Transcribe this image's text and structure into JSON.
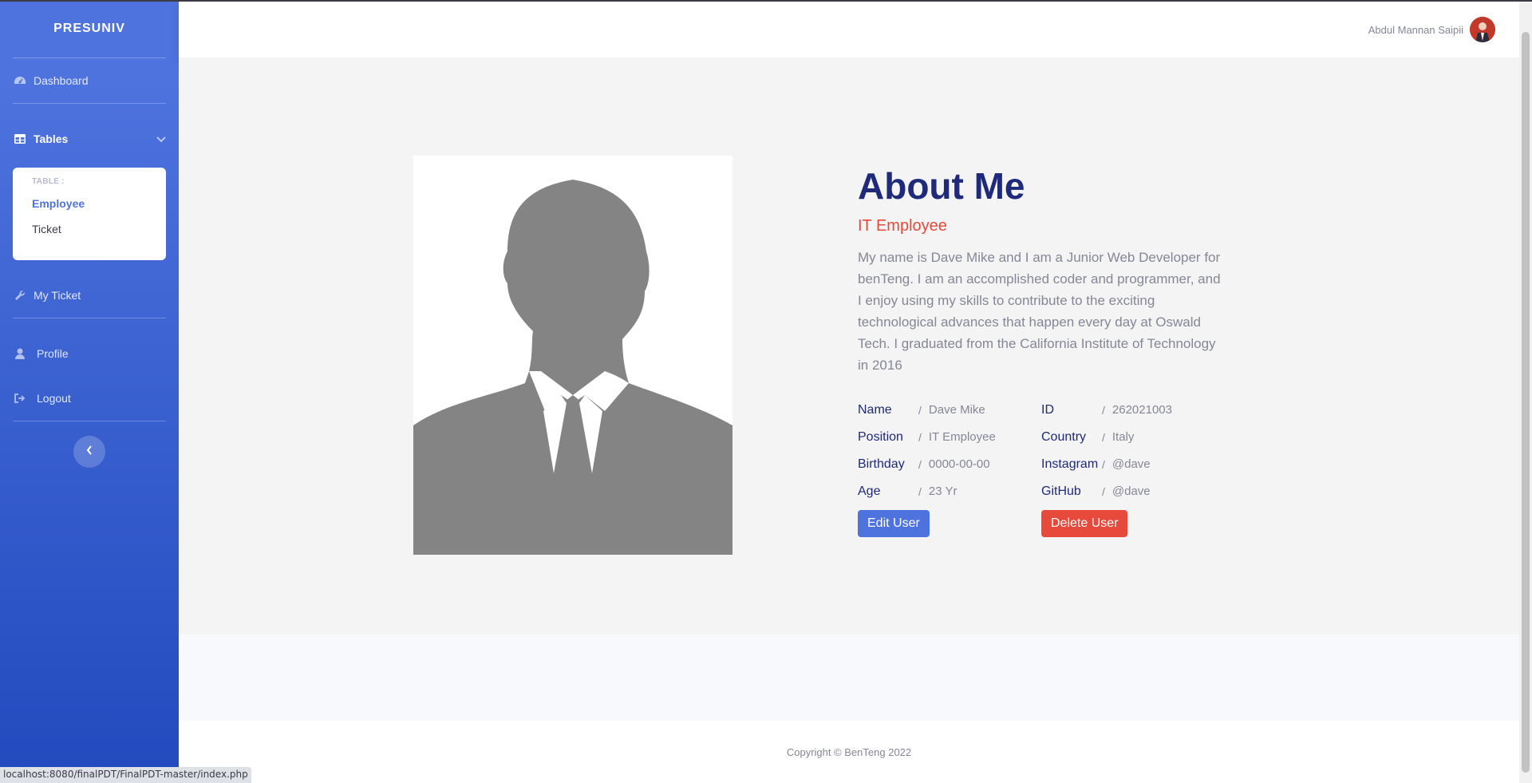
{
  "sidebar": {
    "brand": "PRESUNIV",
    "dashboard_label": "Dashboard",
    "tables_label": "Tables",
    "collapse": {
      "header": "TABLE :",
      "items": [
        {
          "label": "Employee",
          "active": true
        },
        {
          "label": "Ticket",
          "active": false
        }
      ]
    },
    "my_ticket_label": "My Ticket",
    "profile_label": "Profile",
    "logout_label": "Logout"
  },
  "topbar": {
    "user_name": "Abdul Mannan Saipii"
  },
  "about": {
    "title": "About Me",
    "subtitle": "IT Employee",
    "description": "My name is Dave Mike and I am a Junior Web Developer for benTeng. I am an accomplished coder and programmer, and I enjoy using my skills to contribute to the exciting technological advances that happen every day at Oswald Tech. I graduated from the California Institute of Technology in 2016",
    "left_info": [
      {
        "key": "Name",
        "value": "Dave Mike"
      },
      {
        "key": "Position",
        "value": "IT Employee"
      },
      {
        "key": "Birthday",
        "value": "0000-00-00"
      },
      {
        "key": "Age",
        "value": "23 Yr"
      }
    ],
    "right_info": [
      {
        "key": "ID",
        "value": "262021003"
      },
      {
        "key": "Country",
        "value": "Italy"
      },
      {
        "key": "Instagram",
        "value": "@dave"
      },
      {
        "key": "GitHub",
        "value": "@dave"
      }
    ],
    "separator": "/",
    "edit_button": "Edit User",
    "delete_button": "Delete User"
  },
  "footer": {
    "copyright": "Copyright © BenTeng 2022"
  },
  "status_bar": {
    "url": "localhost:8080/finalPDT/FinalPDT-master/index.php"
  },
  "colors": {
    "sidebar_top": "#4e73df",
    "sidebar_bottom": "#224abe",
    "title": "#1f2a7a",
    "accent_red": "#e74a3b",
    "primary": "#4e73df"
  }
}
